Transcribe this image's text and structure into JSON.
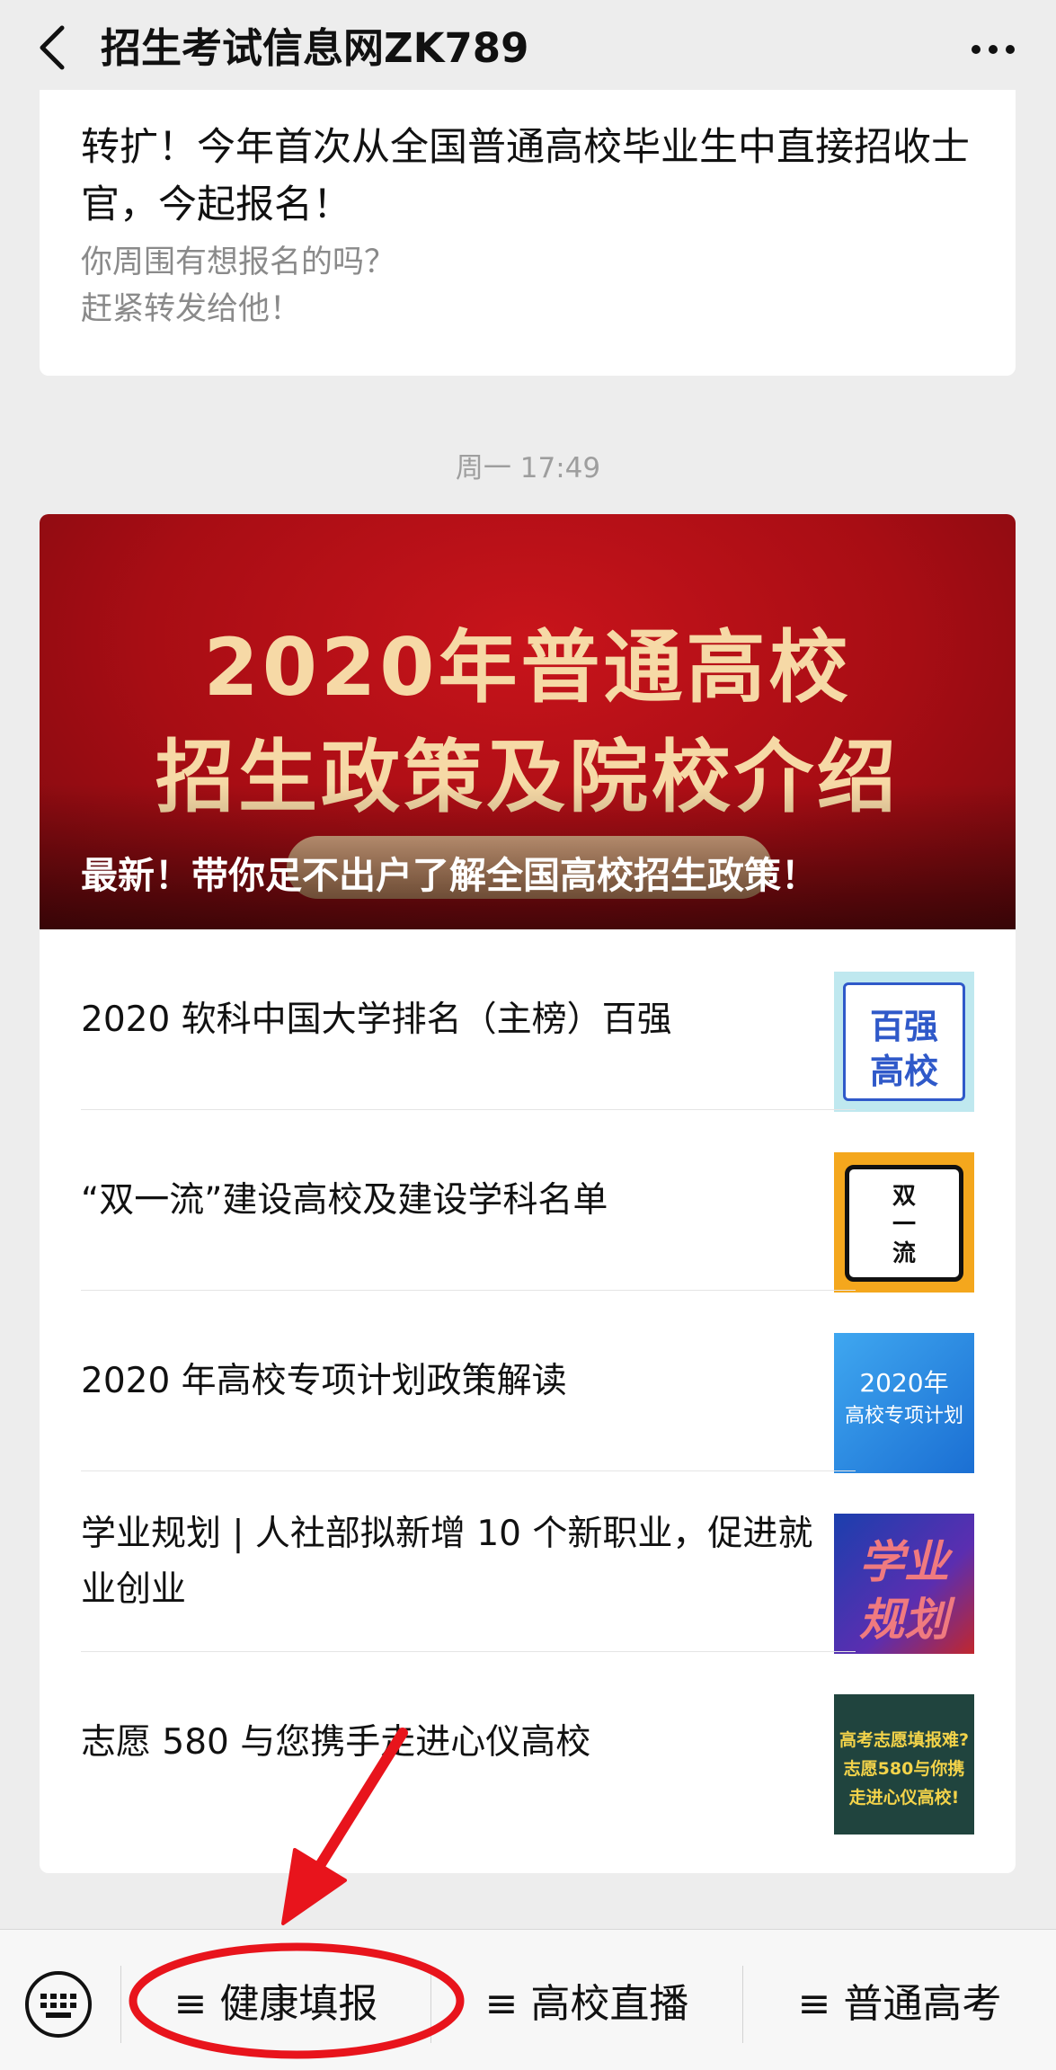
{
  "header": {
    "title": "招生考试信息网ZK789",
    "back_icon": "chevron-left-icon",
    "more_icon": "more-dots-icon"
  },
  "card_top": {
    "title": "转扩！今年首次从全国普通高校毕业生中直接招收士官，今起报名！",
    "desc": "你周围有想报名的吗？\n赶紧转发给他！"
  },
  "timestamp": "周一 17:49",
  "card_main": {
    "cover": {
      "line1": "2020年普通高校",
      "line2": "招生政策及院校介绍",
      "caption": "最新！带你足不出户了解全国高校招生政策！"
    },
    "articles": [
      {
        "title": "2020 软科中国大学排名（主榜）百强",
        "thumb_text": [
          "百强",
          "高校"
        ]
      },
      {
        "title": "“双一流”建设高校及建设学科名单",
        "thumb_text": [
          "双",
          "一",
          "流"
        ]
      },
      {
        "title": "2020 年高校专项计划政策解读",
        "thumb_text": [
          "2020年",
          "高校专项计划"
        ]
      },
      {
        "title": "学业规划 | 人社部拟新增 10 个新职业，促进就业创业",
        "thumb_text": [
          "学业",
          "规划"
        ]
      },
      {
        "title": "志愿 580 与您携手走进心仪高校",
        "thumb_text": [
          "高考志愿填报难?",
          "志愿580与你携",
          "走进心仪高校!"
        ]
      }
    ]
  },
  "bottom_menu": {
    "keyboard_icon": "keyboard-icon",
    "items": [
      "≡ 健康填报",
      "≡ 高校直播",
      "≡ 普通高考"
    ]
  },
  "colors": {
    "annotation_red": "#e8141c",
    "cover_red": "#b00f16",
    "cover_gold": "#f6d9a6"
  }
}
